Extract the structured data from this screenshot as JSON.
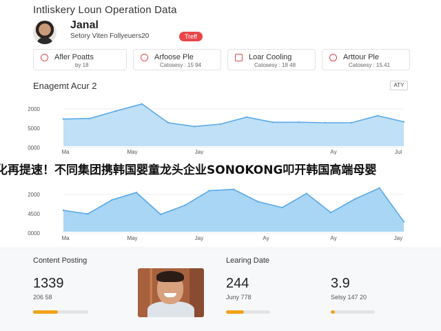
{
  "header": {
    "title": "Intliskery Loun Operation Data"
  },
  "profile": {
    "name": "Janal",
    "subtitle": "Setory Viten Follyeuers20",
    "badge": "Treff",
    "avatar_icon": "user-avatar"
  },
  "cards": [
    {
      "label": "Afler Poatts",
      "sub": "by 18",
      "icon": "warning-icon"
    },
    {
      "label": "Arfoose Ple",
      "sub": "Catosesy : 15 94",
      "icon": "clock-icon"
    },
    {
      "label": "Loar Cooling",
      "sub": "Catosesy : 18 48",
      "icon": "tag-icon"
    },
    {
      "label": "Arttour Ple",
      "sub": "Catosesy : 15.41",
      "icon": "alert-icon"
    }
  ],
  "engagement": {
    "title": "Enagemt Acur 2",
    "button": "ATY"
  },
  "ticker": {
    "text": "化再提速！不同集团携韩国婴童龙头企业SONOKONG叩开韩国高端母婴"
  },
  "chart_data": [
    {
      "type": "area",
      "title": "Enagemt Acur 2",
      "ytick_labels": [
        "2000",
        "5000",
        "0000"
      ],
      "xtick_labels": [
        "Ma",
        "May",
        "Jay",
        "Ay",
        "Jul"
      ],
      "y_values": [
        0.58,
        0.59,
        0.75,
        0.9,
        0.5,
        0.42,
        0.47,
        0.62,
        0.51,
        0.51,
        0.5,
        0.5,
        0.65,
        0.52
      ],
      "ylim": [
        0,
        1
      ],
      "color": "#5aa9e6",
      "fill": "#bfe0f7"
    },
    {
      "type": "area",
      "ytick_labels": [
        "2000",
        "4500",
        "0000"
      ],
      "xtick_labels": [
        "Ma",
        "May",
        "Jay",
        "Ay",
        "Ay",
        "Jay"
      ],
      "y_values": [
        0.47,
        0.39,
        0.7,
        0.86,
        0.38,
        0.58,
        0.9,
        0.93,
        0.66,
        0.53,
        0.84,
        0.42,
        0.72,
        0.96,
        0.22
      ],
      "ylim": [
        0,
        1
      ],
      "color": "#5aa9e6",
      "fill": "#a9d6f5"
    }
  ],
  "stats": [
    {
      "title": "Content Posting",
      "value": "1339",
      "sub": "206 58",
      "progress": 0.45
    },
    {
      "title": "Learing Date",
      "value": "244",
      "sub": "Juny 778",
      "progress": 0.4
    },
    {
      "title": "",
      "value": "3.9",
      "sub": "Selsy 147 20",
      "progress": 0.1
    }
  ],
  "photo": {
    "icon": "person-photo"
  },
  "colors": {
    "accent": "#f2a21c",
    "badge": "#e8474c",
    "chart": "#5aa9e6"
  }
}
